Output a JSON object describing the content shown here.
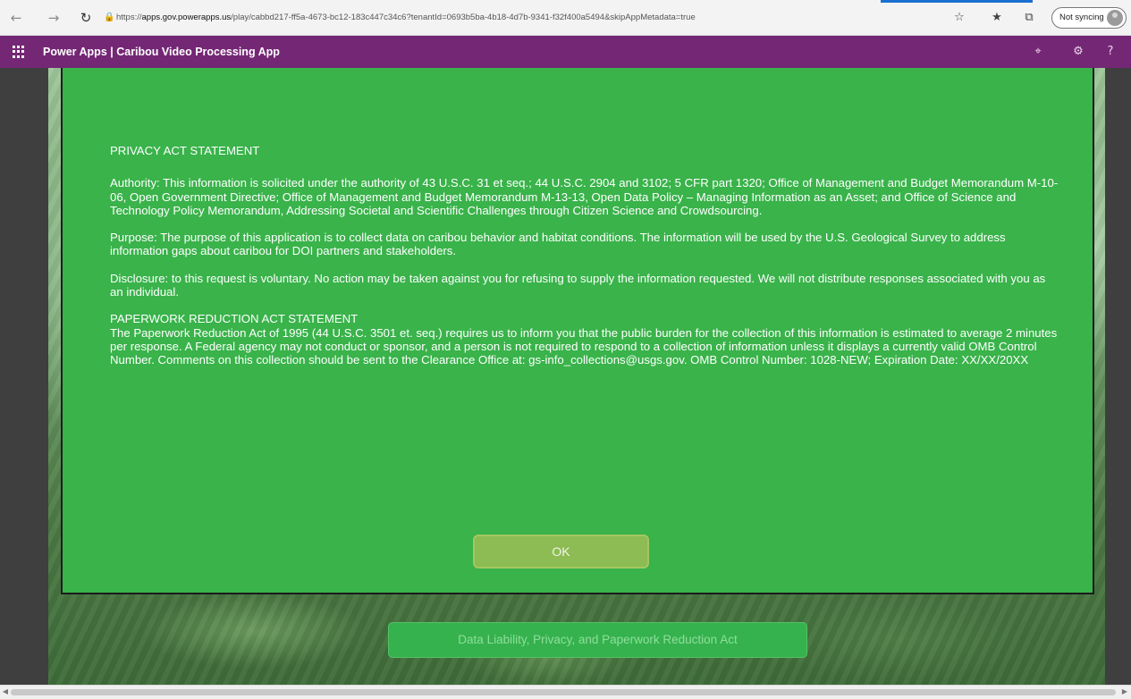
{
  "browser": {
    "url_prefix": "https://",
    "url_host": "apps.gov.powerapps.us",
    "url_path": "/play/cabbd217-ff5a-4673-bc12-183c447c34c6?tenantId=0693b5ba-4b18-4d7b-9341-f32f400a5494&skipAppMetadata=true",
    "sync_label": "Not syncing",
    "icons": {
      "back": "back-arrow-icon",
      "forward": "forward-arrow-icon",
      "refresh": "refresh-icon",
      "lock": "lock-icon",
      "favorite": "add-favorite-icon",
      "favorites": "favorites-icon",
      "collections": "collections-icon",
      "profile": "profile-avatar-icon"
    }
  },
  "app_header": {
    "title": "Power Apps  |  Caribou Video Processing App",
    "background": "#742774",
    "icons": [
      "waffle-icon",
      "fit-to-screen-icon",
      "settings-icon",
      "help-icon"
    ]
  },
  "dialog": {
    "background": "#39b34a",
    "heading": "PRIVACY ACT STATEMENT",
    "authority": "Authority: This information is solicited under the authority of 43 U.S.C. 31 et seq.; 44 U.S.C. 2904 and 3102; 5 CFR part 1320; Office of Management and Budget Memorandum M-10-06, Open Government Directive; Office of Management and Budget Memorandum M-13-13, Open Data Policy – Managing Information as an Asset; and Office of Science and Technology Policy Memorandum, Addressing Societal and Scientific Challenges through Citizen Science and Crowdsourcing.",
    "purpose": "Purpose: The purpose of this application is to collect data on caribou behavior and habitat conditions. The information will be used by the U.S. Geological Survey to address information gaps about caribou for DOI partners and stakeholders.",
    "disclosure": "Disclosure: to this request is voluntary. No action may be taken against you for refusing to supply the information requested. We will not distribute responses associated with you as an individual.",
    "paperwork_heading": "PAPERWORK REDUCTION ACT STATEMENT",
    "paperwork_body": "The Paperwork Reduction Act of 1995 (44 U.S.C. 3501 et. seq.) requires us to inform you that the public burden for the collection of this information is estimated to average 2 minutes per response. A Federal agency may not conduct or sponsor, and a person is not required to respond to a collection of information unless it displays a currently valid OMB Control Number. Comments on this collection should be sent to the Clearance Office at: gs-info_collections@usgs.gov. OMB Control Number: 1028-NEW; Expiration Date: XX/XX/20XX",
    "ok_label": "OK"
  },
  "footer_button": {
    "label": "Data Liability, Privacy, and Paperwork Reduction Act"
  }
}
